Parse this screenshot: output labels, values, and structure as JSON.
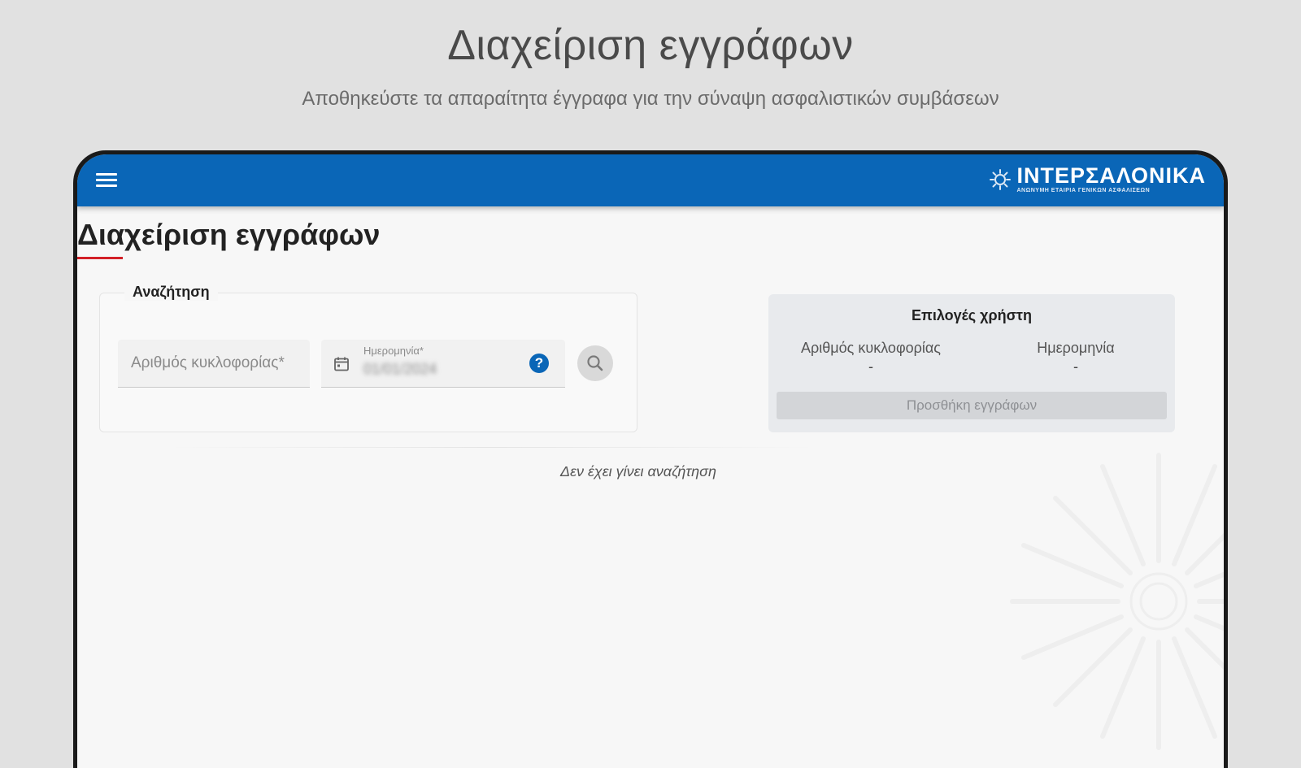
{
  "promo": {
    "title": "Διαχείριση εγγράφων",
    "subtitle": "Αποθηκεύστε τα απαραίτητα έγγραφα για την σύναψη ασφαλιστικών συμβάσεων"
  },
  "appbar": {
    "brand_name": "ΙΝΤΕΡΣΑΛΟΝΙΚΑ",
    "brand_tagline": "ΑΝΩΝΥΜΗ ΕΤΑΙΡΙΑ ΓΕΝΙΚΩΝ ΑΣΦΑΛΙΣΕΩΝ",
    "menu_icon": "hamburger-menu-icon",
    "color": "#0a66b7"
  },
  "page": {
    "heading": "Διαχείριση εγγράφων",
    "accent_color": "#d32027"
  },
  "search": {
    "legend": "Αναζήτηση",
    "plate_placeholder": "Αριθμός κυκλοφορίας*",
    "plate_value": "",
    "date_label": "Ημερομηνία*",
    "date_value": "01/01/2024",
    "help_icon": "help-circle-icon",
    "search_icon": "magnifier-icon"
  },
  "user_options": {
    "title": "Επιλογές χρήστη",
    "plate_label": "Αριθμός κυκλοφορίας",
    "plate_value": "-",
    "date_label": "Ημερομηνία",
    "date_value": "-",
    "add_button_label": "Προσθήκη εγγράφων"
  },
  "results": {
    "empty_message": "Δεν έχει γίνει αναζήτηση"
  }
}
